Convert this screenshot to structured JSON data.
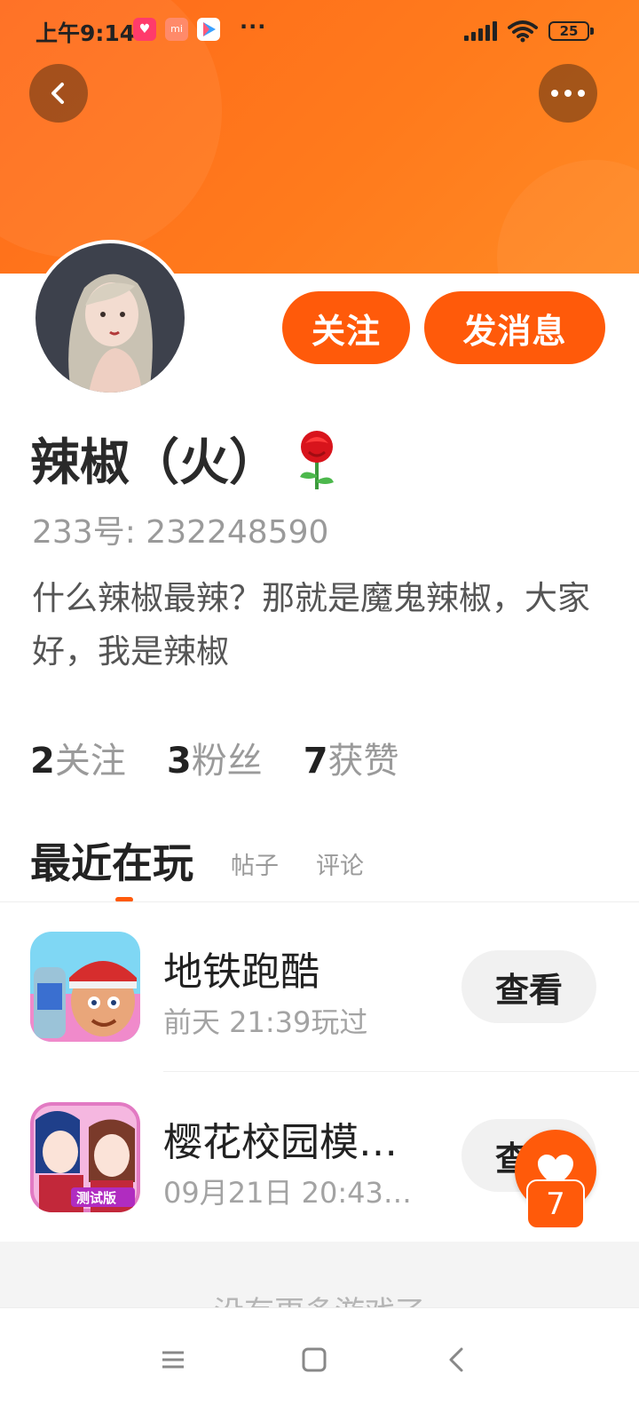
{
  "status_bar": {
    "time": "上午9:14",
    "more": "···",
    "battery": "25",
    "icons": [
      "video-app-icon",
      "mi-store-icon",
      "play-store-icon",
      "signal-icon",
      "wifi-icon",
      "battery-icon"
    ]
  },
  "header": {
    "back_icon": "chevron-left-icon",
    "more_icon": "more-dots-icon",
    "color": "#ff7a1c"
  },
  "profile": {
    "follow_label": "关注",
    "message_label": "发消息",
    "name": "辣椒（火）",
    "name_emoji": "rose-icon",
    "uid": "233号: 232248590",
    "bio": "什么辣椒最辣？那就是魔鬼辣椒，大家好，我是辣椒"
  },
  "stats": [
    {
      "value": "2",
      "label": "关注"
    },
    {
      "value": "3",
      "label": "粉丝"
    },
    {
      "value": "7",
      "label": "获赞"
    }
  ],
  "tabs": [
    {
      "label": "最近在玩",
      "active": true
    },
    {
      "label": "帖子",
      "active": false
    },
    {
      "label": "评论",
      "active": false
    }
  ],
  "games": [
    {
      "title": "地铁跑酷",
      "time": "前天 21:39玩过",
      "button": "查看",
      "icon": "subway-surfers-icon"
    },
    {
      "title": "樱花校园模…",
      "time": "09月21日 20:43…",
      "button": "查看",
      "icon": "sakura-school-icon"
    }
  ],
  "footer": {
    "no_more": "没有更多游戏了"
  },
  "floating_like": {
    "icon": "heart-icon",
    "count": "7"
  },
  "nav": {
    "icons": [
      "menu-icon",
      "home-icon",
      "back-icon"
    ]
  },
  "accent_color": "#ff5a0a"
}
